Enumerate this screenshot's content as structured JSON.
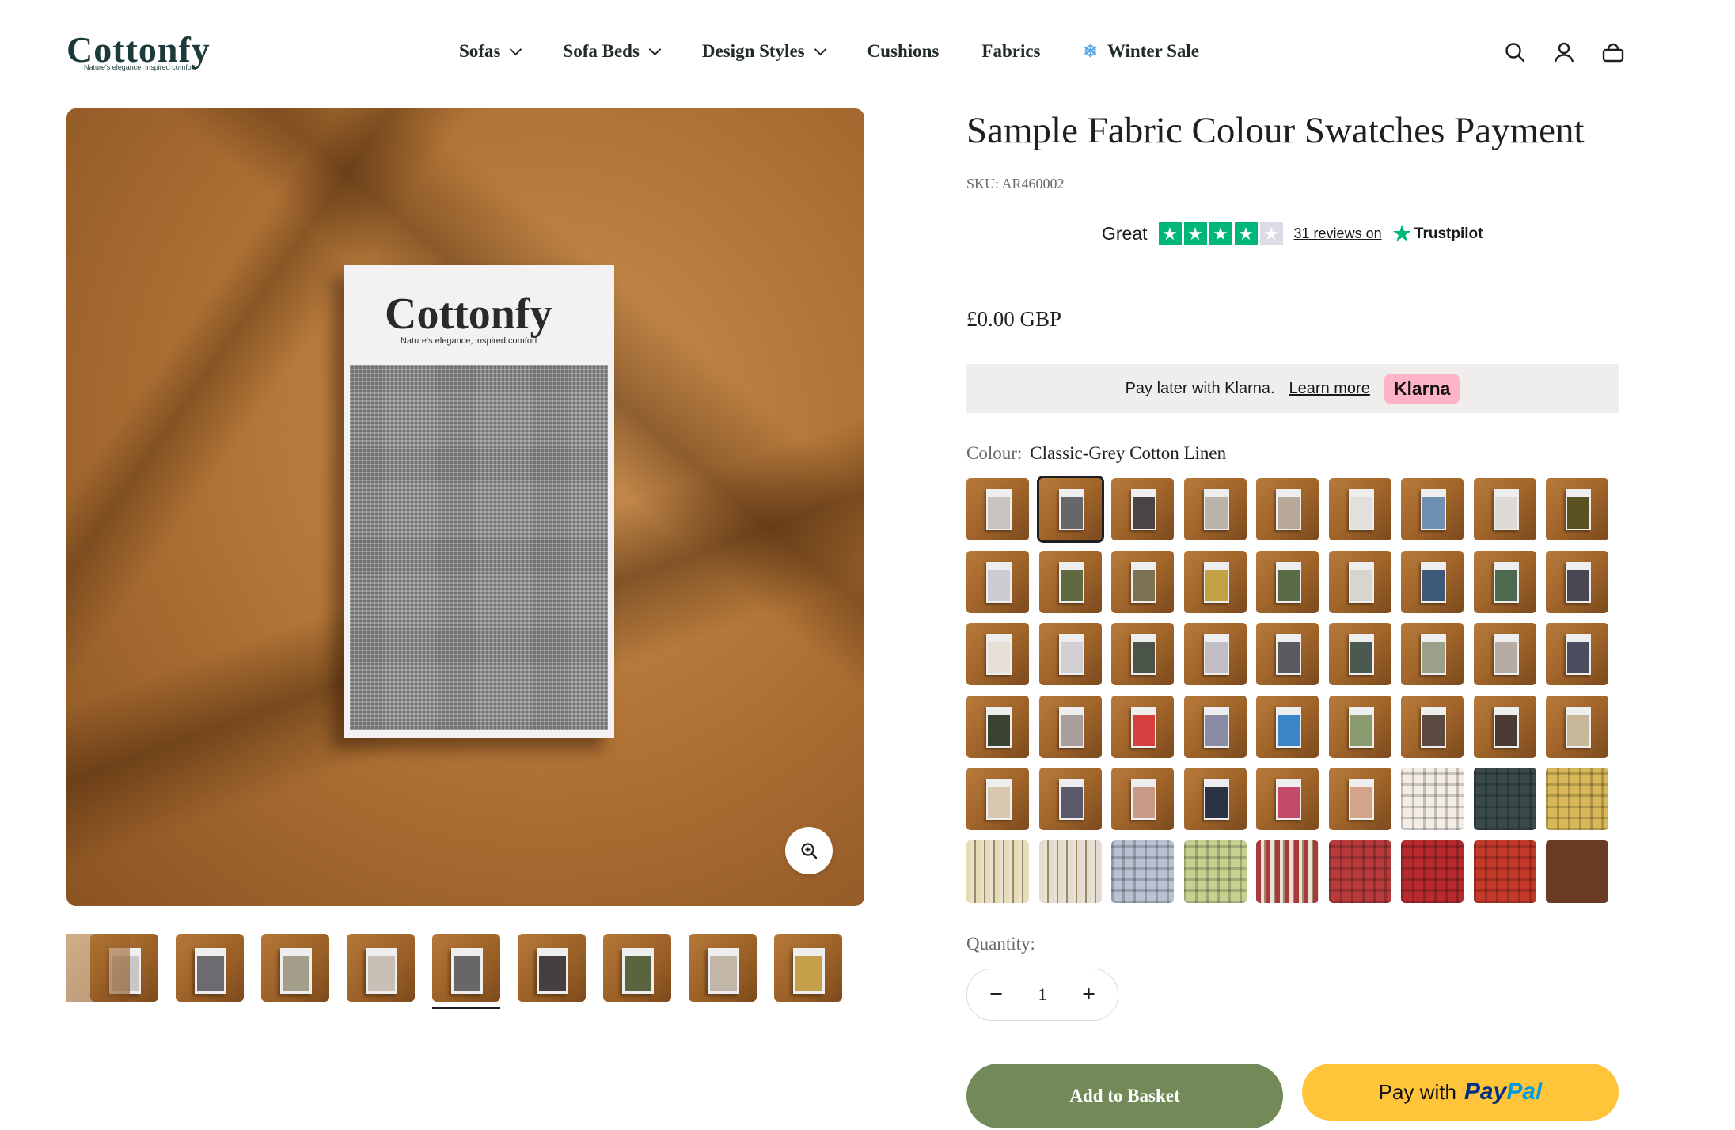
{
  "brand": {
    "name": "Cottonfy",
    "tagline": "Nature's elegance, inspired comfort"
  },
  "nav": [
    {
      "label": "Sofas",
      "dropdown": true
    },
    {
      "label": "Sofa Beds",
      "dropdown": true
    },
    {
      "label": "Design Styles",
      "dropdown": true
    },
    {
      "label": "Cushions",
      "dropdown": false
    },
    {
      "label": "Fabrics",
      "dropdown": false
    },
    {
      "label": "Winter Sale",
      "dropdown": false,
      "icon": "snowflake-icon"
    }
  ],
  "header_icons": [
    "search-icon",
    "account-icon",
    "basket-icon"
  ],
  "product": {
    "title": "Sample Fabric Colour Swatches Payment",
    "sku": "SKU: AR460002",
    "price": "£0.00 GBP"
  },
  "trustpilot": {
    "rating_word": "Great",
    "stars": 4.5,
    "reviews": "31 reviews on",
    "brand": "Trustpilot"
  },
  "klarna": {
    "text": "Pay later with Klarna.",
    "link": "Learn more",
    "badge": "Klarna"
  },
  "colour": {
    "label": "Colour:",
    "value": "Classic-Grey Cotton Linen",
    "selected_index": 1
  },
  "swatch_colors": [
    "#c7c3c0",
    "#66666b",
    "#4b4446",
    "#bcb3aa",
    "#b8a89a",
    "#e2dfdc",
    "#6f8fb3",
    "#dedad6",
    "#5a5222",
    "#cfcbd2",
    "#5f6a40",
    "#7c7150",
    "#c2a145",
    "#5a6a45",
    "#d8d4d0",
    "#3e5a7a",
    "#4e6a4e",
    "#4a4652",
    "#e6e0d6",
    "#d2d0d4",
    "#4a5448",
    "#c2bdc4",
    "#5c5a60",
    "#4a5a50",
    "#9ba08a",
    "#b6aca4",
    "#4a4e5e",
    "#3a4230",
    "#a89e9c",
    "#d84040",
    "#8a8ca6",
    "#3a86c8",
    "#8a9a6e",
    "#5a4a42",
    "#4a3a32",
    "#c8b89a",
    "#d8c8b0",
    "#5a5a6a",
    "#c89a88",
    "#2a3244",
    "#c44a6a",
    "#d4a48a",
    "#f4ece6",
    "#3a4a4a",
    "#d8b858",
    "#e6dcb6",
    "#e4dcd0",
    "#b8c2d2",
    "#c8d090",
    "#a83a3e",
    "#b83a3a",
    "#b82a2e",
    "#c43a2a",
    "#6a3a24"
  ],
  "quantity": {
    "label": "Quantity:",
    "value": "1",
    "minus": "−",
    "plus": "+"
  },
  "buttons": {
    "add": "Add to Basket",
    "paypal_prefix": "Pay with",
    "paypal_a": "Pay",
    "paypal_b": "Pal"
  },
  "thumb_colors": [
    "#c9c6c3",
    "#6c6c70",
    "#a39e8a",
    "#c9bfb4",
    "#67676a",
    "#45403f",
    "#58653f",
    "#c2b6a8",
    "#c5a04a"
  ],
  "selected_thumb": 4
}
